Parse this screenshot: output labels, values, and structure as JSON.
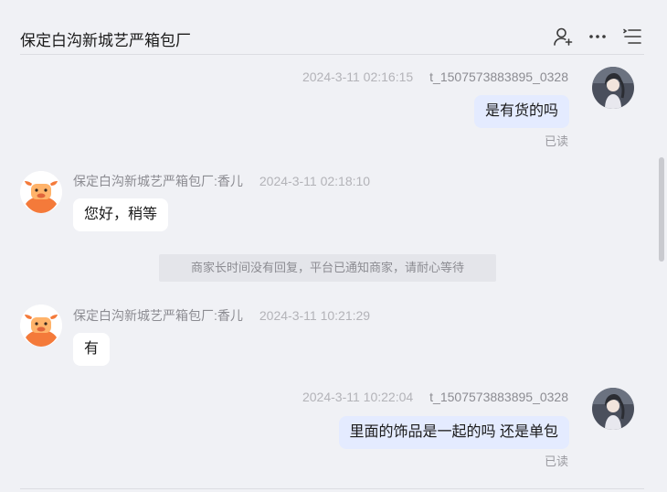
{
  "header": {
    "title": "保定白沟新城艺严箱包厂",
    "icons": [
      "add-user-icon",
      "more-icon",
      "menu-list-icon"
    ]
  },
  "messages": [
    {
      "side": "mine",
      "sender": "t_1507573883895_0328",
      "time": "2024-3-11 02:16:15",
      "text": "是有货的吗",
      "status": "已读"
    },
    {
      "side": "theirs",
      "sender": "保定白沟新城艺严箱包厂:香儿",
      "time": "2024-3-11 02:18:10",
      "text": "您好，稍等"
    },
    {
      "side": "system",
      "text": "商家长时间没有回复，平台已通知商家，请耐心等待"
    },
    {
      "side": "theirs",
      "sender": "保定白沟新城艺严箱包厂:香儿",
      "time": "2024-3-11 10:21:29",
      "text": "有"
    },
    {
      "side": "mine",
      "sender": "t_1507573883895_0328",
      "time": "2024-3-11 10:22:04",
      "text": "里面的饰品是一起的吗 还是单包",
      "status": "已读"
    }
  ],
  "colors": {
    "background": "#f0f1f5",
    "bubble_mine": "#e4ebff",
    "bubble_theirs": "#ffffff",
    "system_bg": "#e4e5ea",
    "shop_avatar_orange": "#f47a3a"
  }
}
